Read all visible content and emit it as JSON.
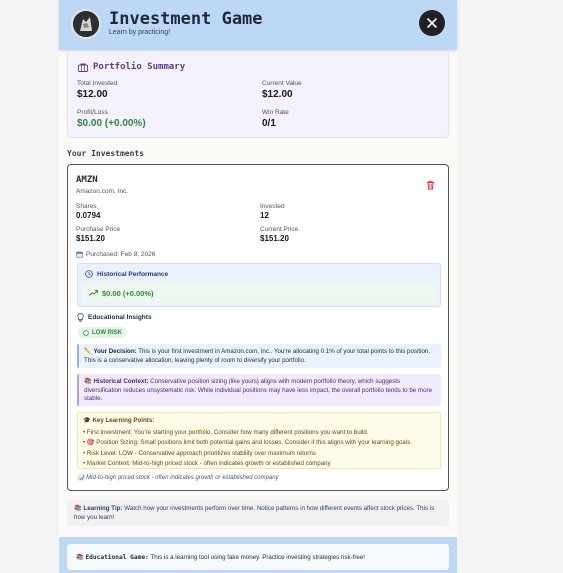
{
  "header": {
    "title": "Investment Game",
    "subtitle": "Learn by practicing!",
    "close_label": "×"
  },
  "portfolio": {
    "title": "Portfolio Summary",
    "total_invested_label": "Total Invested",
    "total_invested": "$12.00",
    "current_value_label": "Current Value",
    "current_value": "$12.00",
    "profit_loss_label": "Profit/Loss",
    "profit_loss": "$0.00 (+0.00%)",
    "win_rate_label": "Win Rate",
    "win_rate": "0/1"
  },
  "investments": {
    "title": "Your Investments",
    "items": [
      {
        "ticker": "AMZN",
        "company": "Amazon.com, Inc.",
        "shares_label": "Shares",
        "shares": "0.0794",
        "invested_label": "Invested",
        "invested": "12",
        "purchase_price_label": "Purchase Price",
        "purchase_price": "$151.20",
        "current_price_label": "Current Price",
        "current_price": "$151.20",
        "purchased": "Purchased: Feb 8, 2026",
        "historical_title": "Historical Performance",
        "historical_value": "$0.00 (+0.00%)",
        "insights_title": "Educational Insights",
        "risk_badge": "LOW RISK",
        "decision_title": "Your Decision:",
        "decision_text": "This is your first investment in Amazon.com, Inc.. You're allocating 0.1% of your total points to this position. This is a conservative allocation, leaving plenty of room to diversify your portfolio.",
        "context_title": "Historical Context:",
        "context_text": "Conservative position sizing (like yours) aligns with modern portfolio theory, which suggests diversification reduces unsystematic risk. While individual positions may have less impact, the overall portfolio tends to be more stable.",
        "learning_title": "Key Learning Points:",
        "learning_points": [
          "• First investment: You're starting your portfolio. Consider how many different positions you want to build.",
          "• 🎯 Position Sizing: Small positions limit both potential gains and losses. Consider if this aligns with your learning goals.",
          "• Risk Level: LOW - Conservative approach prioritizes stability over maximum returns",
          "• Market Context: Mid-to-high priced stock - often indicates growth or established company"
        ],
        "footnote": "Mid-to-high priced stock - often indicates growth or established company"
      }
    ]
  },
  "tip": {
    "title": "Learning Tip:",
    "text": "Watch how your investments perform over time. Notice patterns in how different events affect stock prices. This is how you learn!"
  },
  "footer": {
    "title": "Educational Game:",
    "text": "This is a learning tool using fake money. Practice investing strategies risk-free!"
  },
  "colors": {
    "header_bg": "#bcd8f6",
    "accent_purple": "#5b3a99",
    "gain_green": "#2f8a3f",
    "delete_red": "#dc2626"
  },
  "icons": [
    "wallet-icon",
    "trash-icon",
    "calendar-icon",
    "clock-icon",
    "trending-up-icon",
    "lightbulb-icon",
    "shield-icon",
    "pencil-icon",
    "books-icon",
    "graduation-cap-icon",
    "chart-icon"
  ]
}
